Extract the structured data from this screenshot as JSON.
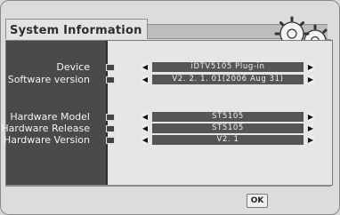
{
  "header": {
    "title": "System Information"
  },
  "fields": [
    {
      "label": "Device",
      "value": "iDTV5105 Plug-in"
    },
    {
      "label": "Software version",
      "value": "V2. 2. 1. 01(2006 Aug 31)"
    },
    {
      "label": "Hardware Model",
      "value": "ST5105"
    },
    {
      "label": "Hardware Release",
      "value": "ST5105"
    },
    {
      "label": "Hardware Version",
      "value": "V2. 1"
    }
  ],
  "controls": {
    "prev_glyph": "◀",
    "next_glyph": "▶"
  },
  "footer": {
    "ok_label": "OK"
  },
  "icons": {
    "decoration": "gears-icon"
  }
}
